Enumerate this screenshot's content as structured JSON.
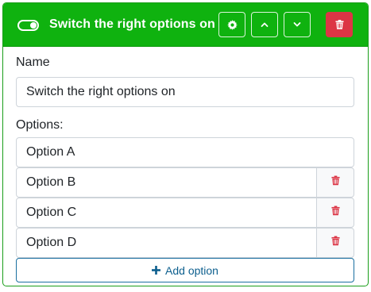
{
  "header": {
    "title": "Switch the right options on",
    "toggle_on": true,
    "color": "#0fb20f"
  },
  "name_field": {
    "label": "Name",
    "value": "Switch the right options on"
  },
  "options": {
    "label": "Options:",
    "items": [
      {
        "value": "Option A",
        "deletable": false
      },
      {
        "value": "Option B",
        "deletable": true
      },
      {
        "value": "Option C",
        "deletable": true
      },
      {
        "value": "Option D",
        "deletable": true
      }
    ]
  },
  "add_button": {
    "label": "Add option"
  },
  "colors": {
    "accent": "#0fb20f",
    "danger": "#dc3545",
    "link": "#0d5f8e"
  }
}
